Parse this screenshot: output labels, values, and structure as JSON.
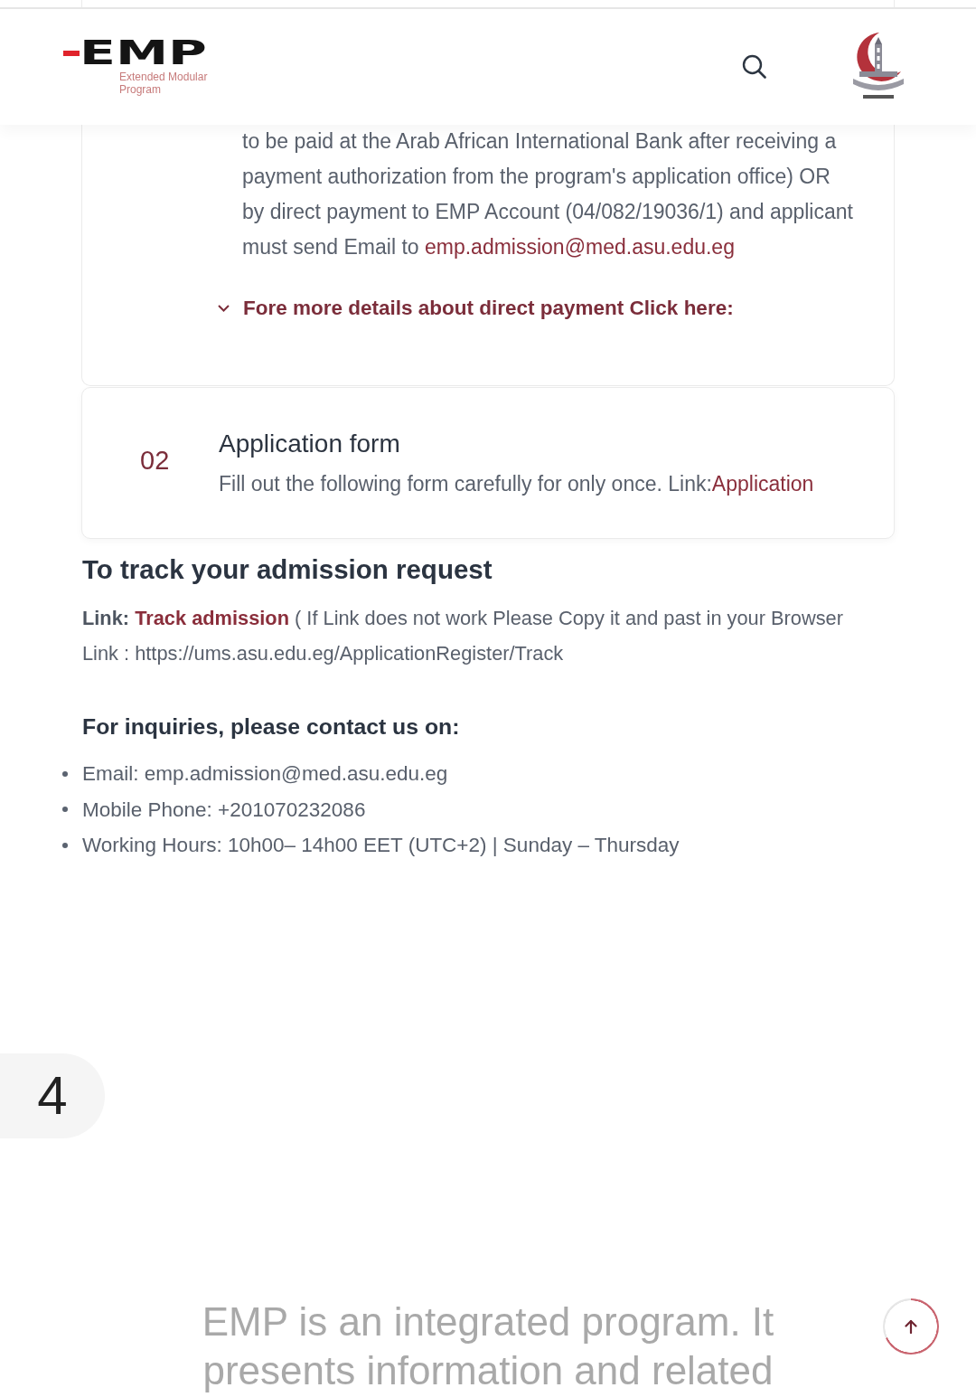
{
  "header": {
    "logo_wordmark": "EMP",
    "logo_tagline": "Extended Modular Program"
  },
  "steps": [
    {
      "kind": "payment",
      "text": "to be paid at the Arab African International Bank after receiving a payment authorization from the program's application office) OR by direct payment to EMP Account (04/082/19036/1) and applicant must send Email to ",
      "email": "emp.admission@med.asu.edu.eg",
      "details_toggle": {
        "label": "Fore more details about direct payment Click here:",
        "expanded": false
      }
    },
    {
      "kind": "form",
      "number": "02",
      "title": "Application form",
      "text": "Fill out the following form carefully for only once. Link:",
      "link": "Application"
    }
  ],
  "track": {
    "heading": "To track your admission request",
    "lead": "**Link:** ",
    "link": "Track admission",
    "text": " ( If Link does not work Please Copy it and past in your Browser Link : https://ums.asu.edu.eg/ApplicationRegister/Track"
  },
  "contact": {
    "heading": "For inquiries, please contact us on:",
    "items": [
      "Email: emp.admission@med.asu.edu.eg",
      "Mobile Phone: +201070232086",
      "Working Hours: 10h00– 14h00 EET (UTC+2) | Sunday – Thursday"
    ]
  },
  "page_badge": "4",
  "footer_intro": "EMP is an integrated program. It presents information and related"
}
